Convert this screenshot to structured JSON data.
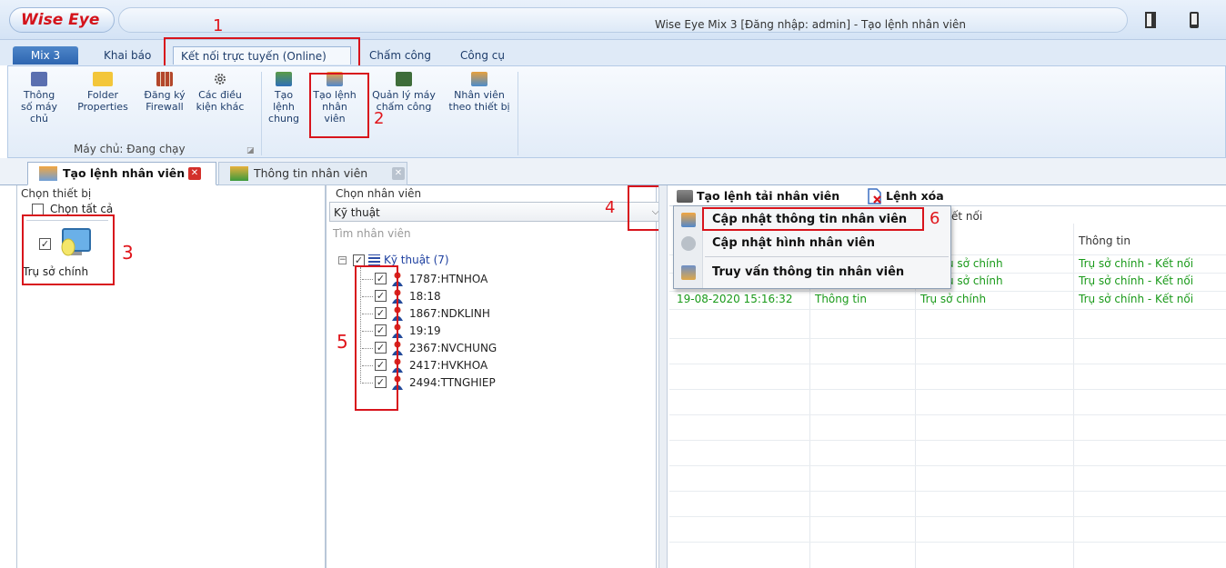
{
  "app": {
    "logo_text": "Wise Eye",
    "window_title": "Wise Eye Mix 3 [Đăng nhập: admin] - Tạo lệnh nhân viên"
  },
  "ribbon": {
    "tabs": [
      {
        "label": "Mix 3"
      },
      {
        "label": "Khai báo"
      },
      {
        "label": "Kết nối trực tuyến (Online)"
      },
      {
        "label": "Chấm công"
      },
      {
        "label": "Công cụ"
      }
    ],
    "buttons": [
      {
        "label": "Thông số máy chủ"
      },
      {
        "label": "Folder Properties"
      },
      {
        "label": "Đăng ký Firewall"
      },
      {
        "label": "Các điều kiện khác"
      },
      {
        "label": "Tạo lệnh chung"
      },
      {
        "label": "Tạo lệnh nhân viên"
      },
      {
        "label": "Quản lý máy chấm công"
      },
      {
        "label": "Nhân viên theo thiết bị"
      }
    ],
    "group_label": "Máy chủ: Đang chạy"
  },
  "doc_tabs": [
    {
      "label": "Tạo lệnh nhân viên"
    },
    {
      "label": "Thông tin nhân viên"
    }
  ],
  "device_panel": {
    "header": "Chọn thiết bị",
    "select_all": "Chọn tất cả",
    "device_label": "Trụ sở chính"
  },
  "employee_panel": {
    "header": "Chọn nhân viên",
    "department_value": "Kỹ thuật",
    "search_placeholder": "Tìm nhân viên",
    "tree_root": "Kỹ thuật (7)",
    "employees": [
      "1787:HTNHOA",
      "18:18",
      "1867:NDKLINH",
      "19:19",
      "2367:NVCHUNG",
      "2417:HVKHOA",
      "2494:TTNGHIEP"
    ]
  },
  "command_panel": {
    "tabs": [
      {
        "label": "Tạo lệnh tải nhân viên"
      },
      {
        "label": "Lệnh xóa"
      }
    ],
    "partial_header": "ết nối",
    "header_info": "Thông tin",
    "rows": [
      {
        "c3": "ụ sở chính",
        "c4": "Trụ sở chính - Kết nối"
      },
      {
        "c3": "ụ sở chính",
        "c4": "Trụ sở chính - Kết nối"
      },
      {
        "c1": "19-08-2020 15:16:32",
        "c2": "Thông tin",
        "c3": "Trụ sở chính",
        "c4": "Trụ sở chính - Kết nối"
      }
    ]
  },
  "context_menu": {
    "items": [
      {
        "label": "Cập nhật thông tin nhân viên"
      },
      {
        "label": "Cập nhật hình nhân viên"
      },
      {
        "label": "Truy vấn thông tin nhân viên"
      }
    ]
  },
  "annotations": [
    "1",
    "2",
    "3",
    "4",
    "5",
    "6"
  ]
}
